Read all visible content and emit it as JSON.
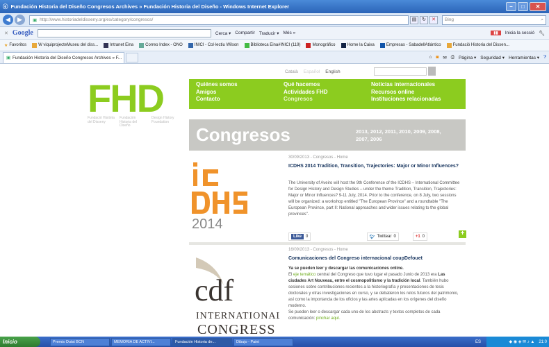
{
  "window": {
    "title": "Fundación Historia del Diseño Congresos Archives » Fundación Historia del Diseño - Windows Internet Explorer"
  },
  "address": {
    "url": "http://www.historiadeldisseny.org/es/category/congresos/",
    "search_placeholder": "Bing"
  },
  "google_bar": {
    "logo": "Google",
    "items": [
      "Cerca ▾",
      "Compartir",
      "Traducir ▾",
      "Més »"
    ],
    "login": "Inicia la sessió"
  },
  "favorites": {
    "label": "Favoritos",
    "items": [
      "W viquiprojecteMuseu del diss...",
      "Intranet Eina",
      "Correo Index - ONO",
      "INICI - Col·lectiu Wilson",
      "Biblioteca Eina#INICI (119)",
      "Monográfico",
      "Home la Caixa",
      "Empresas - SabadellAtlántico",
      "Fundació Historia del Dissen..."
    ]
  },
  "tab": {
    "label": "Fundación Historia del Diseño Congresos Archives » F..."
  },
  "commands": [
    "Página ▾",
    "Seguridad ▾",
    "Herramientas ▾"
  ],
  "site": {
    "languages": [
      "Català",
      "Español",
      "English"
    ],
    "logo": "FHD",
    "logo_sub": [
      "Fundació Història del Disseny",
      "Fundación Historia del Diseño",
      "Design History Foundation"
    ],
    "menu": [
      [
        "Quiénes somos",
        "Amigos",
        "Contacto"
      ],
      [
        "Qué hacemos",
        "Actividades FHD",
        "Congresos"
      ],
      [
        "Noticias internacionales",
        "Recursos online",
        "Instituciones relacionadas"
      ]
    ],
    "banner_title": "Congresos",
    "banner_years": "2013, 2012, 2011, 2010, 2009, 2008, 2007, 2006"
  },
  "posts": [
    {
      "meta": "30/09/2013 - Congresos - Home",
      "title": "ICDHS 2014 Tradition, Transition, Trajectories: Major or Minor Influences?",
      "body": "The University of Aveiro will host the 9th Conference of the ICDHS – International Committee for Design History and Design Studies – under the theme Tradition, Transition, Trajectories: Major or Minor Influences? 9-11 July, 2014. Prior to the conference, on 8 July, two sessions will be organized: a workshop entitled \"The European Province\" and a roundtable \"The European Province, part II: National approaches and wider issues relating to the global provinces\".",
      "logo_year": "2014",
      "share": {
        "like": "Like",
        "like_count": "0",
        "tweet": "Twittear",
        "tweet_count": "0",
        "gplus": "+1",
        "gplus_count": "0"
      }
    },
    {
      "meta": "16/09/2013 - Congresos - Home",
      "title": "Comunicaciones del Congreso internacional coupDefouet",
      "lead": "Ya se pueden leer y descargar las comunicaciones online.",
      "body_prefix": "El ",
      "body_link": "eje temático",
      "body_mid": " central del Congreso que tuvo lugar el pasado Junio de 2013 era ",
      "body_bold": "Las ciudades Art Nouveau, entre el cosmopolitismo y la tradición local",
      "body_rest": ". También hubo sesiones sobre contribuciones recientes a la historiografía y presentaciones de tesis doctorales y otras investigaciones en curso, y se debatieron los retos futuros del patrimonio, así como la importancia de los oficios y las artes aplicadas en los orígenes del diseño moderno.",
      "body_end": "Se pueden leer o descargar cada uno de los abstracts y textos completos de cada comunicación: ",
      "body_end_link": "pinchar aquí.",
      "logo_main": "cdf",
      "logo_sub1": "INTERNATIONAL",
      "logo_sub2": "CONGRESS"
    }
  ],
  "taskbar": {
    "start": "Inicio",
    "tasks": [
      "Premis Outst BCN",
      "MEMORIA DE ACTIVI...",
      "Fundación Historia de...",
      "Dibujo - Paint"
    ],
    "locale": "ES",
    "clock": "21:0"
  }
}
